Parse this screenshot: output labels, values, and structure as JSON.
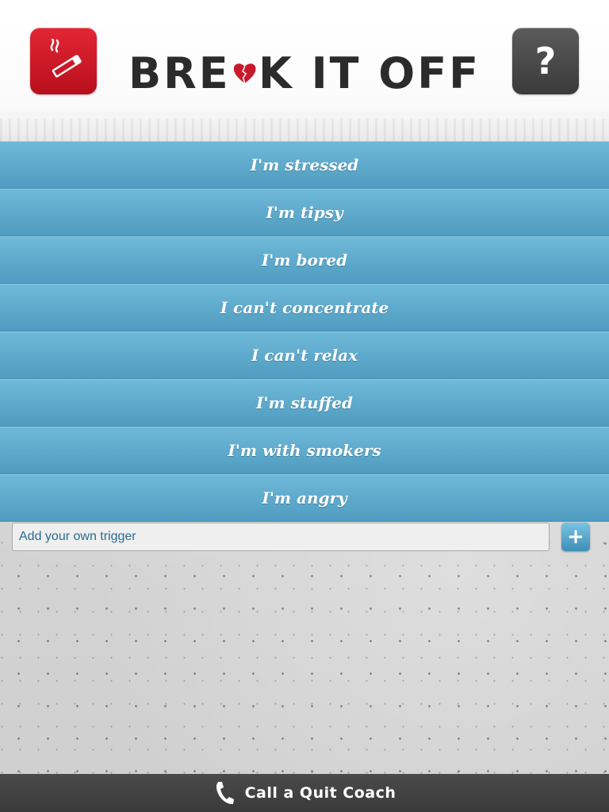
{
  "header": {
    "logo_text_left": "BRE",
    "logo_text_right": "K IT OFF",
    "smoke_icon": "cigarette-icon",
    "help_label": "?",
    "brand_red": "#d21d2a",
    "help_gray": "#4a4a4a"
  },
  "triggers": [
    {
      "label": "I'm stressed"
    },
    {
      "label": "I'm tipsy"
    },
    {
      "label": "I'm bored"
    },
    {
      "label": "I can't concentrate"
    },
    {
      "label": "I can't relax"
    },
    {
      "label": "I'm stuffed"
    },
    {
      "label": "I'm with smokers"
    },
    {
      "label": "I'm angry"
    }
  ],
  "add_trigger": {
    "placeholder": "Add your own trigger",
    "value": "",
    "button_label": "+"
  },
  "footer": {
    "label": "Call a Quit Coach",
    "icon": "phone-icon"
  },
  "colors": {
    "trigger_blue": "#5fa9cc",
    "footer_bg": "#424242"
  }
}
